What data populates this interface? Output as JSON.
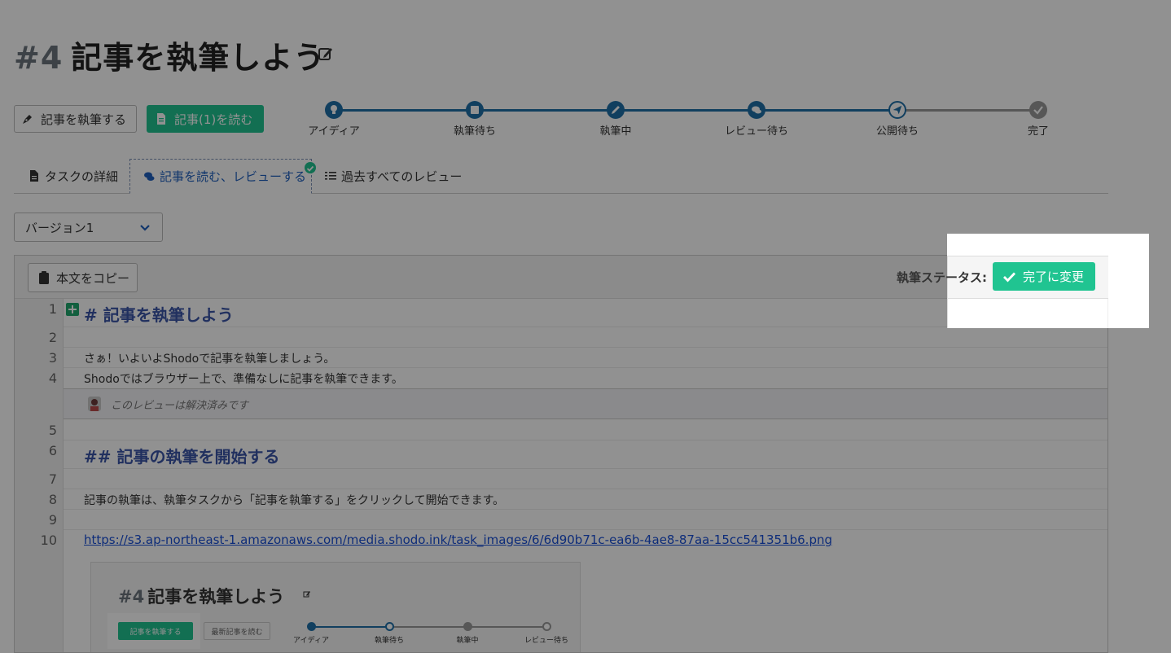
{
  "header": {
    "task_number": "#4",
    "title": "記事を執筆しよう"
  },
  "actions": {
    "write_label": "記事を執筆する",
    "read_label": "記事(1)を読む"
  },
  "progress": {
    "steps": [
      "アイディア",
      "執筆待ち",
      "執筆中",
      "レビュー待ち",
      "公開待ち",
      "完了"
    ],
    "current_step": "公開待ち",
    "active_color": "#1e6fa8",
    "inactive_color": "#9a9a9a"
  },
  "tabs": {
    "detail": "タスクの詳細",
    "review": "記事を読む、レビューする",
    "past": "過去すべてのレビュー"
  },
  "version": {
    "selected": "バージョン1"
  },
  "editor": {
    "copy_label": "本文をコピー",
    "status_label": "執筆ステータス:",
    "complete_label": "完了に変更",
    "line_numbers": [
      "1",
      "2",
      "3",
      "4",
      "5",
      "6",
      "7",
      "8",
      "9",
      "10"
    ],
    "lines": {
      "l1": "# 記事を執筆しよう",
      "l3": "さぁ！いよいよShodoで記事を執筆しましょう。",
      "l4": "Shodoではブラウザー上で、準備なしに記事を執筆できます。",
      "l6": "## 記事の執筆を開始する",
      "l8": "記事の執筆は、執筆タスクから「記事を執筆する」をクリックして開始できます。",
      "l10": "https://s3.ap-northeast-1.amazonaws.com/media.shodo.ink/task_images/6/6d90b71c-ea6b-4ae8-87aa-15cc541351b6.png"
    },
    "review_note": "このレビューは解決済みです"
  },
  "embedded_screenshot": {
    "task_number": "#4",
    "title": "記事を執筆しよう",
    "write_label": "記事を執筆する",
    "latest_label": "最新記事を読む",
    "steps": [
      "アイディア",
      "執筆待ち",
      "執筆中",
      "レビュー待ち"
    ]
  },
  "colors": {
    "primary_green": "#20c491",
    "heading_blue": "#3a55a8",
    "link_blue": "#1a4fd6"
  }
}
